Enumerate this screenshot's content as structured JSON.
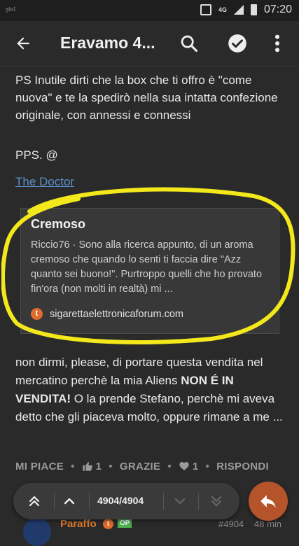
{
  "status_bar": {
    "left_text": "𝔤𝔟𝔢𝔩",
    "network": "4G",
    "time": "07:20"
  },
  "header": {
    "title": "Eravamo 4..."
  },
  "post": {
    "paragraph1": "PS Inutile dirti che la box che ti offro è \"come nuova\" e te la spedirò nella sua intatta confezione originale, con annessi e connessi",
    "pps": "PPS. @",
    "mention": "The Doctor"
  },
  "onebox": {
    "title": "Cremoso",
    "excerpt": "Riccio76 · Sono alla ricerca appunto, di un aroma cremoso che quando lo senti ti faccia dire \"Azz quanto sei buono!\". Purtroppo quelli che ho provato fin'ora (non molti in realtà) mi ...",
    "favicon_letter": "t",
    "source": "sigarettaelettronicaforum.com",
    "highlight_color": "#f2e81b"
  },
  "post2": {
    "part1": "non dirmi, please, di portare questa vendita nel mercatino perchè la mia Aliens ",
    "bold": "NON É IN VENDITA!",
    "part2": " O la prende Stefano, perchè mi aveva detto che gli piaceva molto, oppure rimane a me ..."
  },
  "actions": {
    "like_label": "MI PIACE",
    "like_count": "1",
    "thanks_label": "GRAZIE",
    "heart_count": "1",
    "reply_label": "RISPONDI"
  },
  "progress": {
    "counter": "4904/4904"
  },
  "next_post": {
    "username": "Paraffo",
    "badge_letter": "t",
    "op_label": "OP",
    "number": "#4904",
    "time": "48 min"
  },
  "colors": {
    "accent": "#b5542a",
    "link": "#5b8fc9",
    "background": "#2a2a2a"
  }
}
